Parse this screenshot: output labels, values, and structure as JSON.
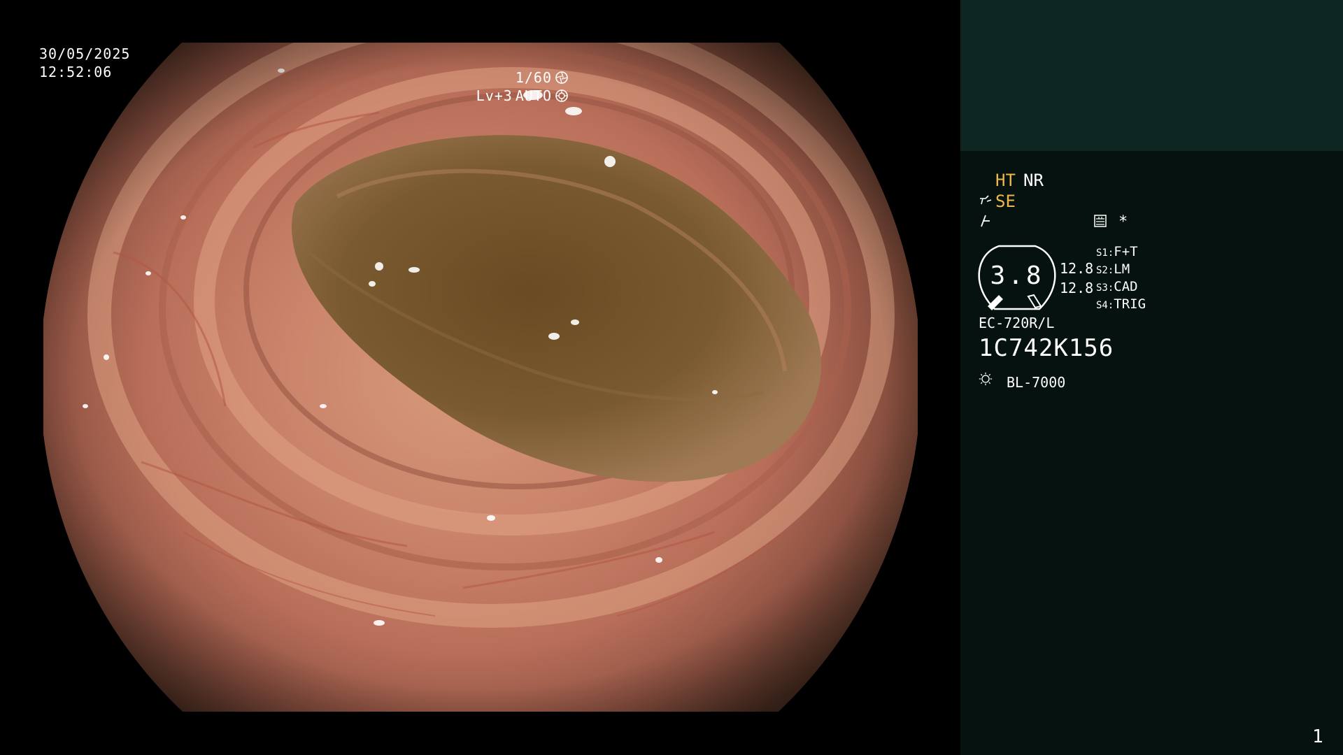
{
  "overlay": {
    "date": "30/05/2025",
    "time": "12:52:06",
    "shutter": "1/60",
    "shutter_icon": "shutter-icon",
    "level": "Lv+3",
    "iris": "AUTO",
    "iris_icon": "iris-icon"
  },
  "panel": {
    "ht": "HT",
    "nr": "NR",
    "se": "SE",
    "star": "*",
    "dial_value": "3.8",
    "value_1": "12.8",
    "value_2": "12.8",
    "switches": [
      {
        "key": "S1:",
        "value": "F+T"
      },
      {
        "key": "S2:",
        "value": "LM"
      },
      {
        "key": "S3:",
        "value": "CAD"
      },
      {
        "key": "S4:",
        "value": "TRIG"
      }
    ],
    "scope_model": "EC-720R/L",
    "serial": "1C742K156",
    "light_source": "BL-7000",
    "page_number": "1"
  },
  "colors": {
    "panel_bg": "#05120f",
    "panel_top_bg": "#0e2622",
    "accent_yellow": "#f0b84a",
    "mucosa": "#c9826a"
  }
}
